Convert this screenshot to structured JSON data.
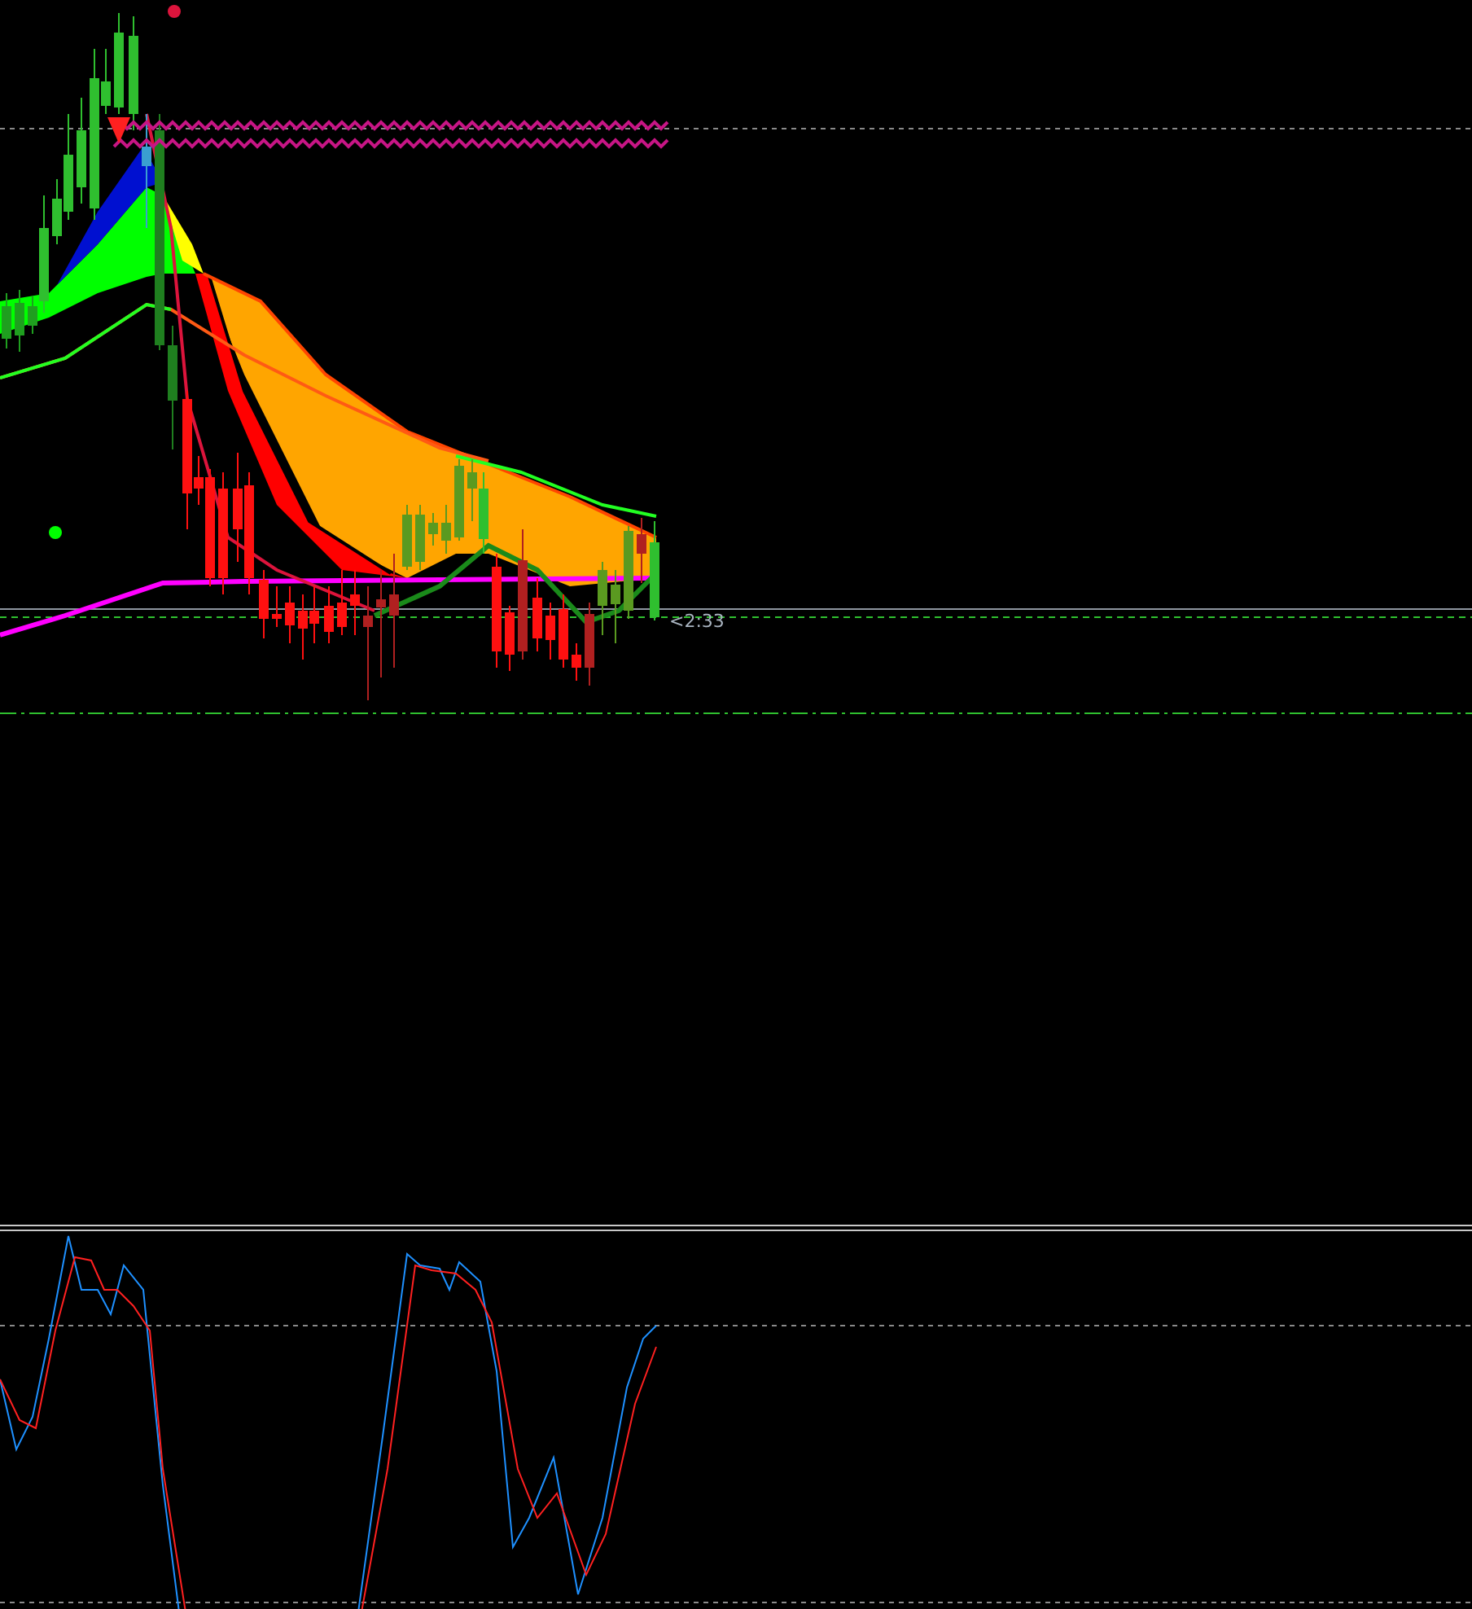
{
  "main_chart": {
    "countdown": "<2:33"
  }
}
